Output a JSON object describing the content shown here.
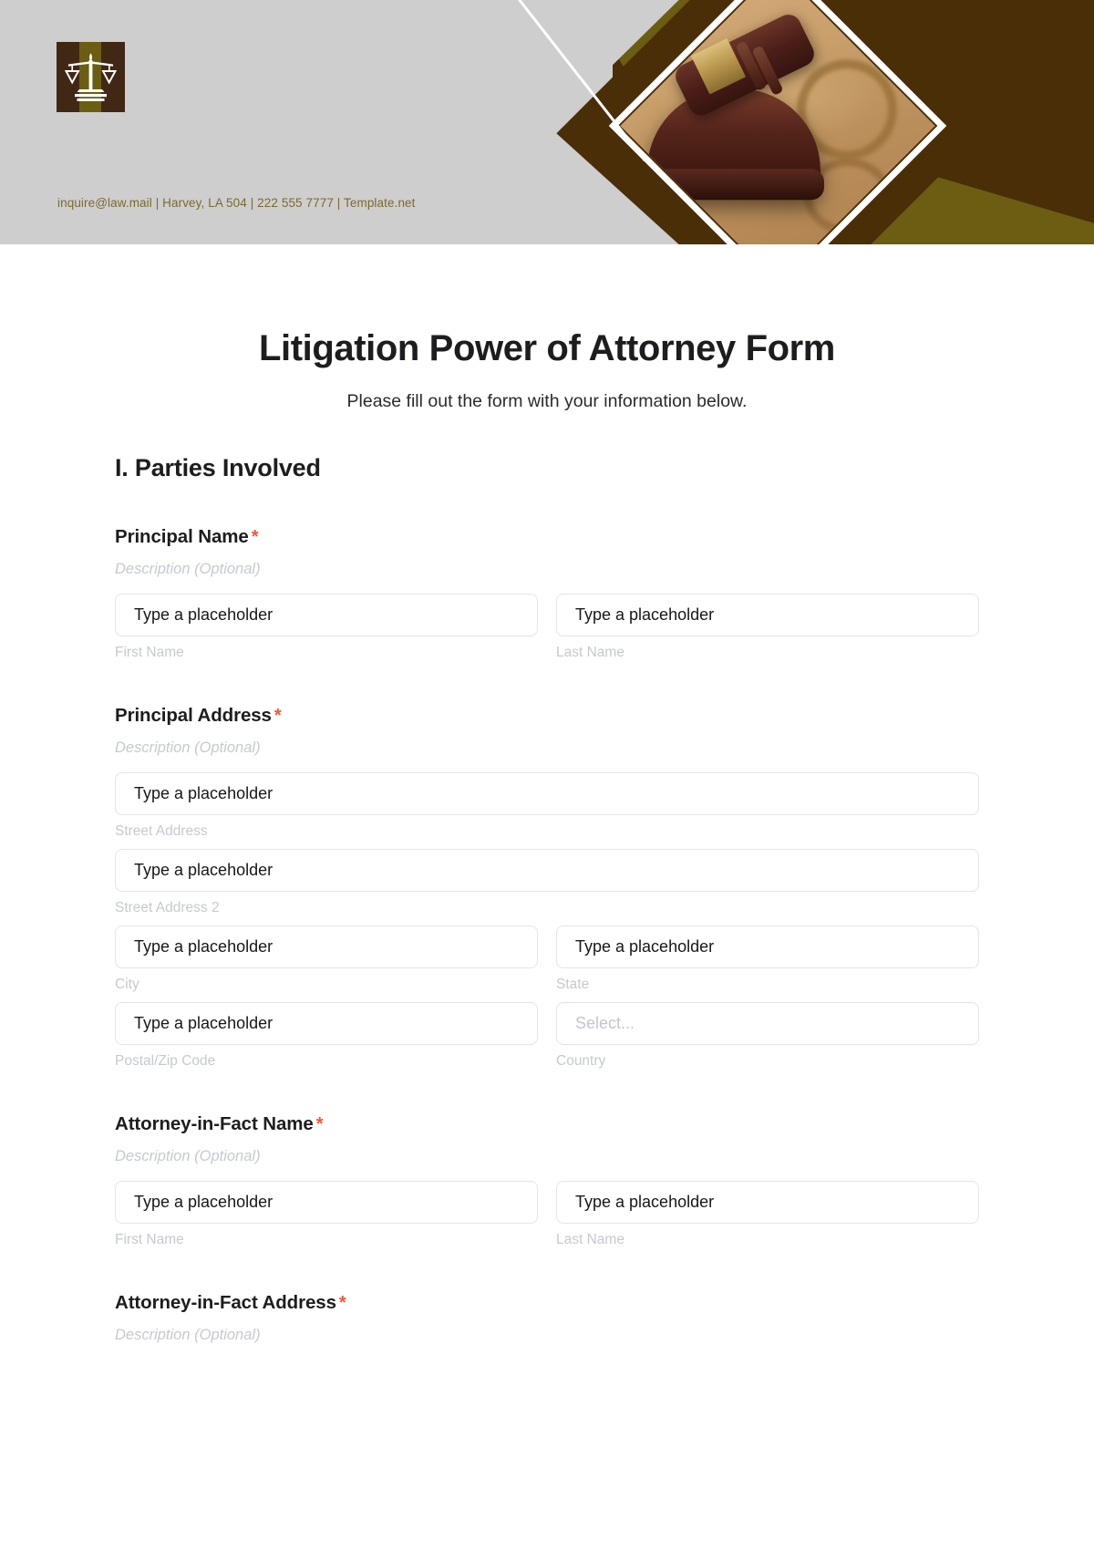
{
  "header": {
    "logo_icon": "scales-of-justice-icon",
    "contact_line": "inquire@law.mail | Harvey, LA 504 | 222 555 7777 | Template.net",
    "photo_alt": "gavel-photo",
    "colors": {
      "background": "#cecece",
      "brown": "#4a2e08",
      "olive": "#6b5e12",
      "logo_brown": "#402814",
      "contact_text": "#7a6a2e"
    }
  },
  "form": {
    "title": "Litigation Power of Attorney Form",
    "subtitle": "Please fill out the form with your information below.",
    "required_marker": "*",
    "description_placeholder": "Description (Optional)",
    "input_placeholder": "Type a placeholder",
    "select_placeholder": "Select...",
    "required_color": "#f4553d",
    "sections": [
      {
        "heading": "I. Parties Involved",
        "fields": [
          {
            "label": "Principal Name",
            "required": true,
            "description": "Description (Optional)",
            "type": "name",
            "rows": [
              {
                "inputs": [
                  {
                    "placeholder": "Type a placeholder",
                    "sub_label": "First Name",
                    "kind": "text"
                  },
                  {
                    "placeholder": "Type a placeholder",
                    "sub_label": "Last Name",
                    "kind": "text"
                  }
                ]
              }
            ]
          },
          {
            "label": "Principal Address",
            "required": true,
            "description": "Description (Optional)",
            "type": "address",
            "rows": [
              {
                "inputs": [
                  {
                    "placeholder": "Type a placeholder",
                    "sub_label": "Street Address",
                    "kind": "text"
                  }
                ]
              },
              {
                "inputs": [
                  {
                    "placeholder": "Type a placeholder",
                    "sub_label": "Street Address 2",
                    "kind": "text"
                  }
                ]
              },
              {
                "inputs": [
                  {
                    "placeholder": "Type a placeholder",
                    "sub_label": "City",
                    "kind": "text"
                  },
                  {
                    "placeholder": "Type a placeholder",
                    "sub_label": "State",
                    "kind": "text"
                  }
                ]
              },
              {
                "inputs": [
                  {
                    "placeholder": "Type a placeholder",
                    "sub_label": "Postal/Zip Code",
                    "kind": "text"
                  },
                  {
                    "placeholder": "Select...",
                    "sub_label": "Country",
                    "kind": "select"
                  }
                ]
              }
            ]
          },
          {
            "label": "Attorney-in-Fact Name",
            "required": true,
            "description": "Description (Optional)",
            "type": "name",
            "rows": [
              {
                "inputs": [
                  {
                    "placeholder": "Type a placeholder",
                    "sub_label": "First Name",
                    "kind": "text"
                  },
                  {
                    "placeholder": "Type a placeholder",
                    "sub_label": "Last Name",
                    "kind": "text"
                  }
                ]
              }
            ]
          },
          {
            "label": "Attorney-in-Fact Address",
            "required": true,
            "description": "Description (Optional)",
            "type": "address",
            "rows": []
          }
        ]
      }
    ]
  }
}
